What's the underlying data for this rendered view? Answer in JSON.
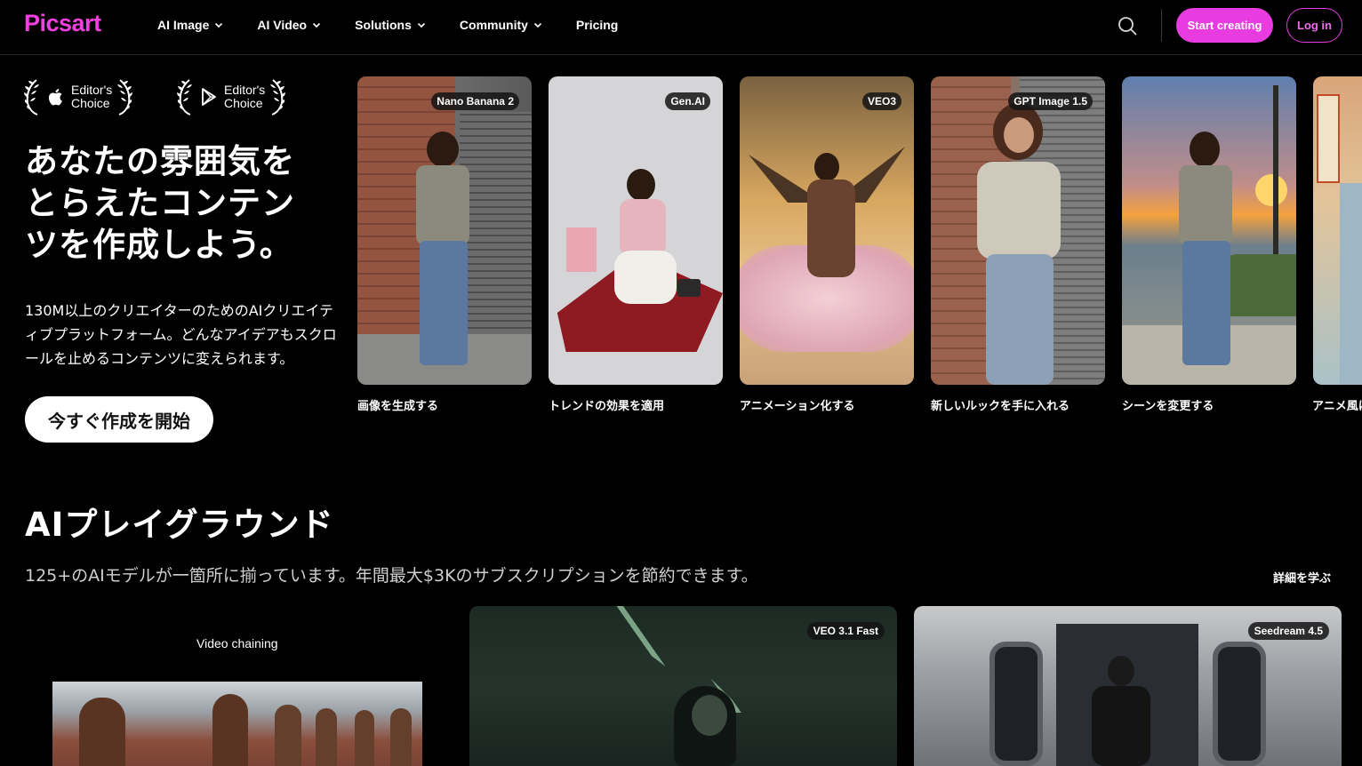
{
  "header": {
    "logo": "Picsart",
    "nav": [
      {
        "label": "AI Image",
        "has_dropdown": true
      },
      {
        "label": "AI Video",
        "has_dropdown": true
      },
      {
        "label": "Solutions",
        "has_dropdown": true
      },
      {
        "label": "Community",
        "has_dropdown": true
      },
      {
        "label": "Pricing",
        "has_dropdown": false
      }
    ],
    "start_label": "Start creating",
    "login_label": "Log in"
  },
  "awards": [
    {
      "store": "apple-icon",
      "line1": "Editor's",
      "line2": "Choice"
    },
    {
      "store": "google-play-icon",
      "line1": "Editor's",
      "line2": "Choice"
    }
  ],
  "hero": {
    "title": "あなたの雰囲気をとらえたコンテンツを作成しよう。",
    "subtitle": "130M以上のクリエイターのためのAIクリエイティブプラットフォーム。どんなアイデアもスクロールを止めるコンテンツに変えられます。",
    "cta": "今すぐ作成を開始"
  },
  "cards": [
    {
      "badge": "Nano Banana 2",
      "label": "画像を生成する"
    },
    {
      "badge": "Gen.AI",
      "label": "トレンドの効果を適用"
    },
    {
      "badge": "VEO3",
      "label": "アニメーション化する"
    },
    {
      "badge": "GPT Image 1.5",
      "label": "新しいルックを手に入れる"
    },
    {
      "badge": "",
      "label": "シーンを変更する"
    },
    {
      "badge": "",
      "label": "アニメ風に"
    }
  ],
  "playground": {
    "title": "AIプレイグラウンド",
    "subtitle": "125+のAIモデルが一箇所に揃っています。年間最大$3Kのサブスクリプションを節約できます。",
    "learn_more": "詳細を学ぶ",
    "tiles": [
      {
        "label": "Video chaining",
        "badge": ""
      },
      {
        "label": "",
        "badge": "VEO 3.1 Fast"
      },
      {
        "label": "",
        "badge": "Seedream 4.5"
      }
    ]
  },
  "colors": {
    "accent": "#e83ce0",
    "background": "#000000"
  }
}
